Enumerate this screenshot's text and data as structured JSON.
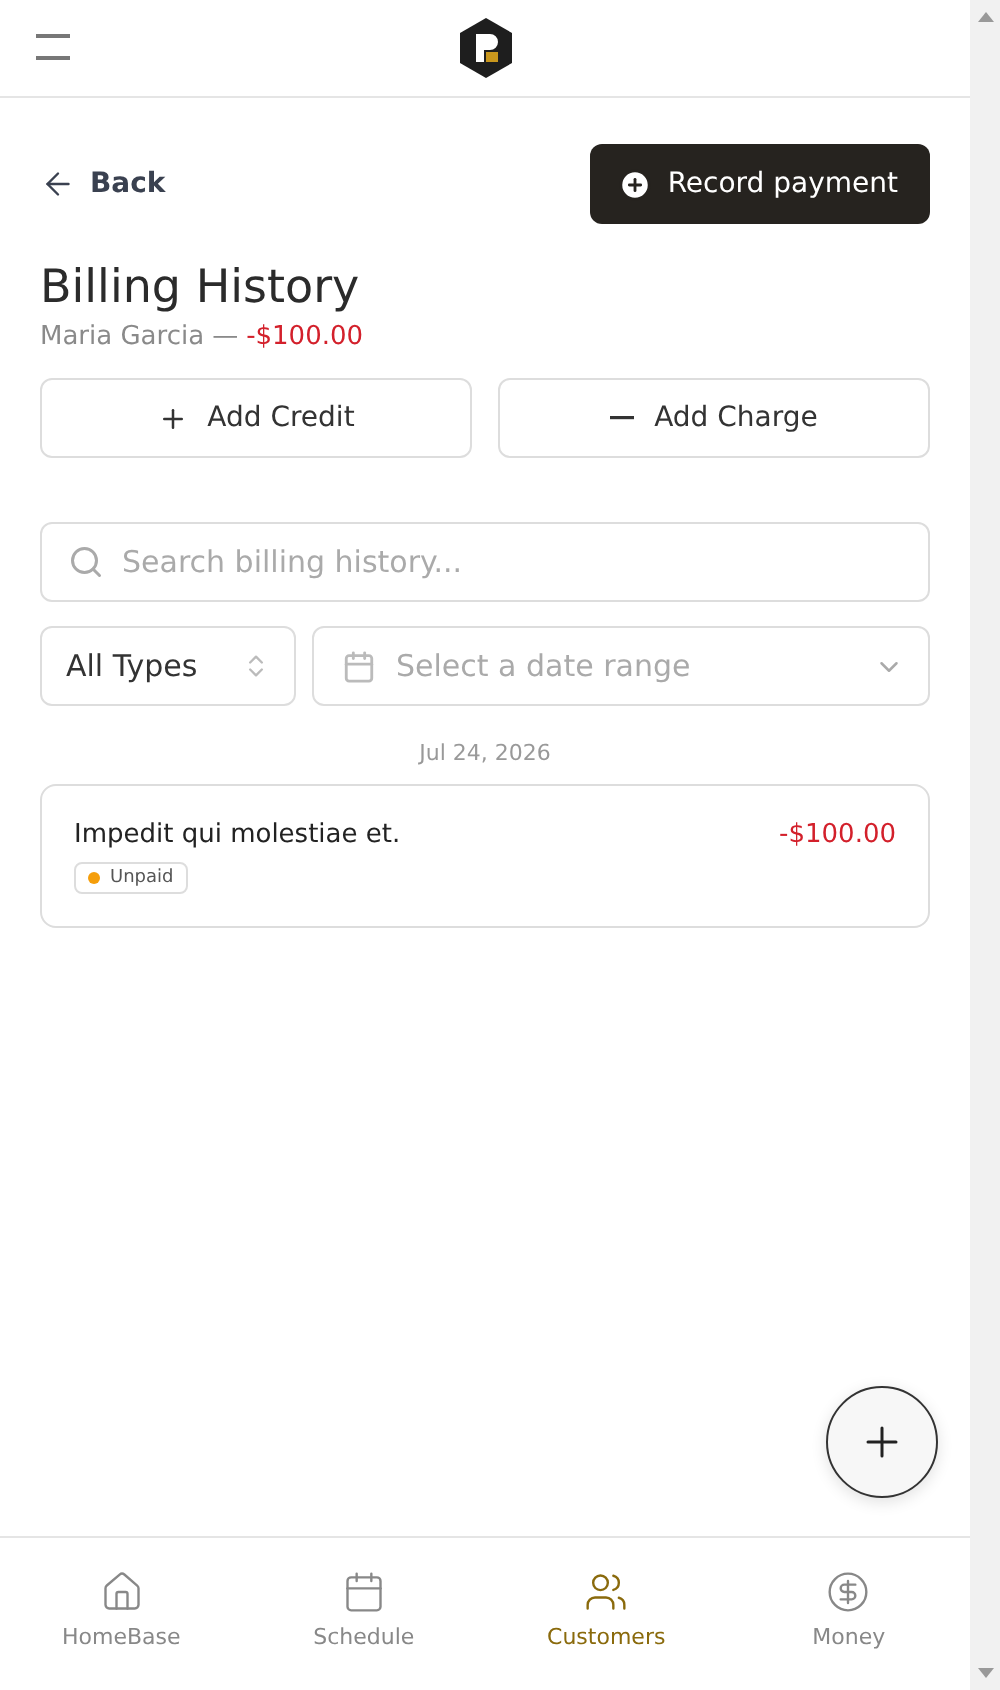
{
  "back": {
    "label": "Back"
  },
  "primary_action": {
    "label": "Record payment"
  },
  "title": "Billing History",
  "customer": {
    "name": "Maria Garcia",
    "separator": "—",
    "balance": "-$100.00"
  },
  "actions": [
    {
      "kind": "credit",
      "label": "Add Credit"
    },
    {
      "kind": "charge",
      "label": "Add Charge"
    }
  ],
  "search": {
    "placeholder": "Search billing history..."
  },
  "filters": {
    "type": "All Types",
    "date_placeholder": "Select a date range"
  },
  "groups": [
    {
      "date": "Jul 24, 2026",
      "entries": [
        {
          "title": "Impedit qui molestiae et.",
          "amount": "-$100.00",
          "status": "Unpaid",
          "color": "#f59e0b"
        }
      ]
    }
  ],
  "nav": [
    {
      "label": "HomeBase",
      "selected": false
    },
    {
      "label": "Schedule",
      "selected": false
    },
    {
      "label": "Customers",
      "selected": true
    },
    {
      "label": "Money",
      "selected": false
    }
  ]
}
